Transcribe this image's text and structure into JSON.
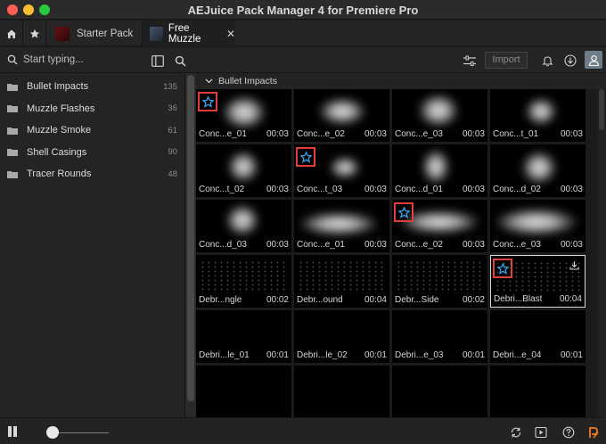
{
  "window": {
    "title": "AEJuice Pack Manager 4 for Premiere Pro"
  },
  "tabs": [
    {
      "label": "Starter Pack"
    },
    {
      "label": "Free Muzzle"
    }
  ],
  "search": {
    "placeholder": "Start typing..."
  },
  "toolbar": {
    "import_label": "Import"
  },
  "categories": [
    {
      "label": "Bullet Impacts",
      "count": "135"
    },
    {
      "label": "Muzzle Flashes",
      "count": "36"
    },
    {
      "label": "Muzzle Smoke",
      "count": "61"
    },
    {
      "label": "Shell Casings",
      "count": "90"
    },
    {
      "label": "Tracer Rounds",
      "count": "48"
    }
  ],
  "group": {
    "title": "Bullet Impacts"
  },
  "items": [
    {
      "name": "Conc...e_01",
      "duration": "00:03"
    },
    {
      "name": "Conc...e_02",
      "duration": "00:03"
    },
    {
      "name": "Conc...e_03",
      "duration": "00:03"
    },
    {
      "name": "Conc...t_01",
      "duration": "00:03"
    },
    {
      "name": "Conc...t_02",
      "duration": "00:03"
    },
    {
      "name": "Conc...t_03",
      "duration": "00:03"
    },
    {
      "name": "Conc...d_01",
      "duration": "00:03"
    },
    {
      "name": "Conc...d_02",
      "duration": "00:03"
    },
    {
      "name": "Conc...d_03",
      "duration": "00:03"
    },
    {
      "name": "Conc...e_01",
      "duration": "00:03"
    },
    {
      "name": "Conc...e_02",
      "duration": "00:03"
    },
    {
      "name": "Conc...e_03",
      "duration": "00:03"
    },
    {
      "name": "Debr...ngle",
      "duration": "00:02"
    },
    {
      "name": "Debr...ound",
      "duration": "00:04"
    },
    {
      "name": "Debr...Side",
      "duration": "00:02"
    },
    {
      "name": "Debri...Blast",
      "duration": "00:04"
    },
    {
      "name": "Debri...le_01",
      "duration": "00:01"
    },
    {
      "name": "Debri...le_02",
      "duration": "00:01"
    },
    {
      "name": "Debri...e_03",
      "duration": "00:01"
    },
    {
      "name": "Debri...e_04",
      "duration": "00:01"
    }
  ],
  "colors": {
    "star": "#3aa0e8",
    "highlight": "#e23c3c",
    "accent": "#f07a1c"
  }
}
